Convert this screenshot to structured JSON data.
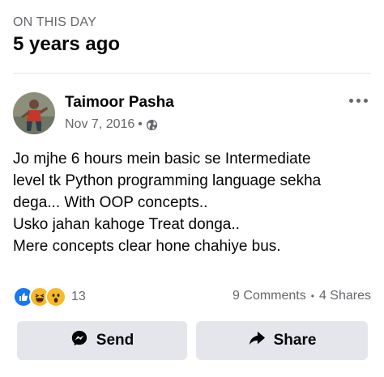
{
  "memory": {
    "kicker": "ON THIS DAY",
    "title": "5 years ago"
  },
  "post": {
    "author": "Taimoor Pasha",
    "date": "Nov 7, 2016",
    "separator": "•",
    "privacy_icon": "globe-icon",
    "lines": [
      "Jo mjhe 6 hours mein basic se Intermediate",
      "level tk Python programming language sekha",
      "dega... With OOP concepts..",
      "Usko jahan kahoge Treat donga..",
      "Mere concepts clear hone chahiye bus."
    ]
  },
  "stats": {
    "reaction_icons": [
      "like-icon",
      "haha-icon",
      "wow-icon"
    ],
    "reaction_count": "13",
    "comments": "9 Comments",
    "dot": "•",
    "shares": "4 Shares"
  },
  "actions": {
    "send_label": "Send",
    "share_label": "Share"
  },
  "colors": {
    "like": "#1877f2",
    "reaction_yellow": "#f7b928",
    "muted_text": "#65676b",
    "button_bg": "#e4e6eb"
  }
}
